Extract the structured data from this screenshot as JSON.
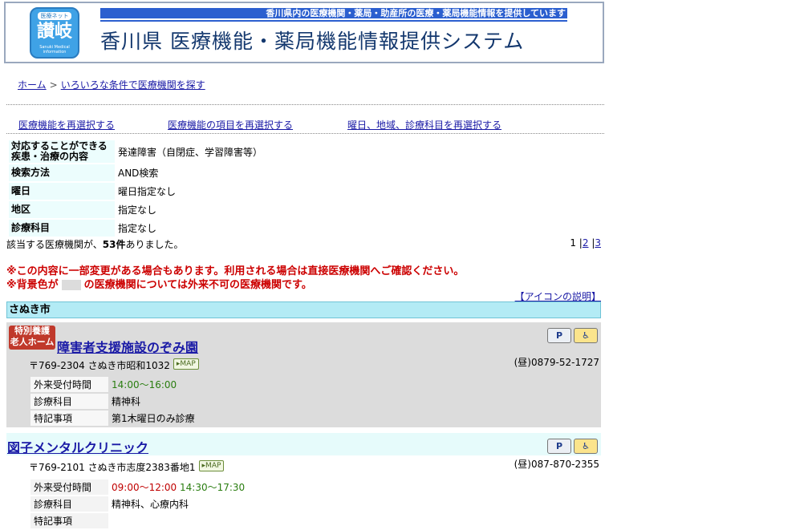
{
  "header": {
    "logo_top": "医療ネット",
    "logo_main": "讃岐",
    "logo_sub": "Sanuki Medical information",
    "tagline": "香川県内の医療機関・薬局・助産所の医療・薬局機能情報を提供しています",
    "title": "香川県 医療機能・薬局機能情報提供システム"
  },
  "breadcrumb": {
    "home": "ホーム",
    "separator": ">",
    "current": "いろいろな条件で医療機関を探す"
  },
  "reselect": [
    "医療機能を再選択する",
    "医療機能の項目を再選択する",
    "曜日、地域、診療科目を再選択する"
  ],
  "conditions": [
    {
      "label": "対応することができる疾患・治療の内容",
      "value": "発達障害（自閉症、学習障害等）"
    },
    {
      "label": "検索方法",
      "value": "AND検索"
    },
    {
      "label": "曜日",
      "value": "曜日指定なし"
    },
    {
      "label": "地区",
      "value": "指定なし"
    },
    {
      "label": "診療科目",
      "value": "指定なし"
    }
  ],
  "results": {
    "prefix": "該当する医療機関が、",
    "count": "53件",
    "suffix": "ありました。"
  },
  "pager": {
    "current": "1",
    "sep": "|",
    "p2": "2",
    "p3": "3"
  },
  "notices": {
    "line1": "※この内容に一部変更がある場合もあります。利用される場合は直接医療機関へご確認ください。",
    "line2_a": "※背景色が",
    "line2_b": "の医療機関については外来不可の医療機関です。"
  },
  "icon_help": "【アイコンの説明】",
  "region": "さぬき市",
  "facilities": [
    {
      "badge_line1": "特別養護",
      "badge_line2": "老人ホーム",
      "name": "障害者支援施設のぞみ園",
      "address": "〒769-2304 さぬき市昭和1032",
      "map": "▸MAP",
      "tel": "(昼)0879-52-1727",
      "icon_p": "P",
      "icon_wc": "♿",
      "rows": [
        {
          "label": "外来受付時間",
          "value": "14:00～16:00"
        },
        {
          "label": "診療科目",
          "value": "精神科"
        },
        {
          "label": "特記事項",
          "value": "第1木曜日のみ診療"
        }
      ]
    },
    {
      "name": "図子メンタルクリニック",
      "address": "〒769-2101 さぬき市志度2383番地1",
      "map": "▸MAP",
      "tel": "(昼)087-870-2355",
      "icon_p": "P",
      "icon_wc": "♿",
      "rows": [
        {
          "label": "外来受付時間",
          "value_a": "09:00～12:00",
          "value_b": "14:30～17:30"
        },
        {
          "label": "診療科目",
          "value": "精神科、心療内科"
        },
        {
          "label": "特記事項",
          "value": ""
        }
      ]
    }
  ],
  "colors": {
    "link": "#1a1aa6",
    "notice": "#cc0000",
    "region_bg": "#b3ebf5",
    "closed_bg": "#dcdcdc"
  }
}
